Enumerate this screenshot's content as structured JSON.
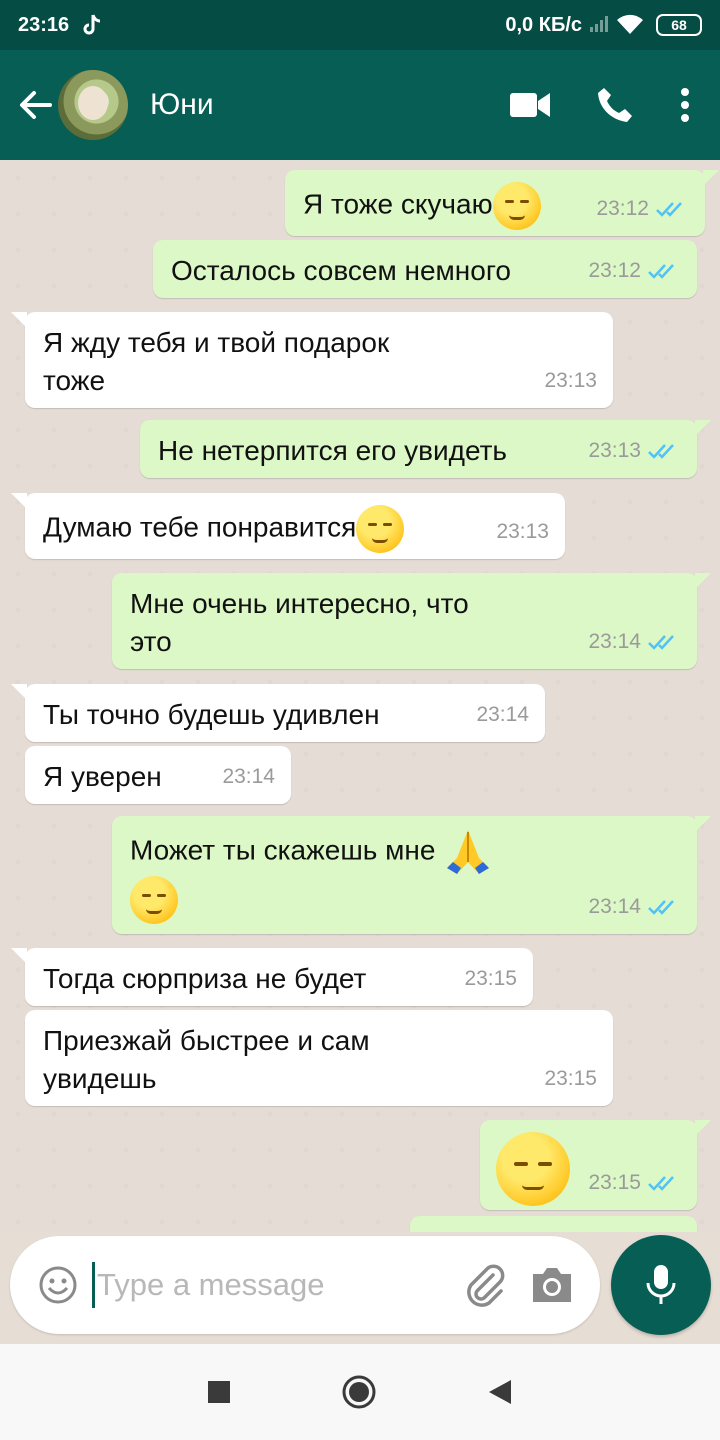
{
  "status_bar": {
    "time": "23:16",
    "network_speed": "0,0 КБ/с",
    "battery": "68",
    "icons": [
      "tiktok-icon",
      "signal-icon",
      "wifi-icon",
      "battery-icon"
    ]
  },
  "header": {
    "contact_name": "Юни",
    "icons": [
      "back-arrow-icon",
      "video-call-icon",
      "voice-call-icon",
      "more-options-icon"
    ]
  },
  "messages": [
    {
      "direction": "out",
      "text": "Я тоже скучаю",
      "emoji": "pensive-face",
      "time": "23:12",
      "status": "read"
    },
    {
      "direction": "out",
      "text": "Осталось совсем немного",
      "time": "23:12",
      "status": "read"
    },
    {
      "direction": "in",
      "text_line1": "Я жду тебя и твой подарок",
      "text_line2": "тоже",
      "time": "23:13"
    },
    {
      "direction": "out",
      "text": "Не нетерпится его увидеть",
      "time": "23:13",
      "status": "read"
    },
    {
      "direction": "in",
      "text": "Думаю тебе понравится",
      "emoji": "winking-face",
      "time": "23:13"
    },
    {
      "direction": "out",
      "text_line1": "Мне очень интересно, что",
      "text_line2": "это",
      "time": "23:14",
      "status": "read"
    },
    {
      "direction": "in",
      "text": "Ты точно будешь удивлен",
      "time": "23:14"
    },
    {
      "direction": "in",
      "text": "Я уверен",
      "time": "23:14"
    },
    {
      "direction": "out",
      "text": "Может ты скажешь мне",
      "emoji": "folded-hands",
      "emoji2": "smirking-face",
      "time": "23:14",
      "status": "read"
    },
    {
      "direction": "in",
      "text": "Тогда сюрприза не будет",
      "time": "23:15"
    },
    {
      "direction": "in",
      "text_line1": "Приезжай быстрее и сам",
      "text_line2": "увидешь",
      "time": "23:15"
    },
    {
      "direction": "out",
      "emoji": "pensive-face",
      "time": "23:15",
      "status": "read"
    }
  ],
  "composer": {
    "placeholder": "Type a message",
    "value": "",
    "icons": [
      "emoji-icon",
      "attach-icon",
      "camera-icon",
      "mic-icon"
    ]
  },
  "nav": {
    "icons": [
      "recents-icon",
      "home-icon",
      "back-icon"
    ]
  },
  "colors": {
    "header": "#075e54",
    "status_bar": "#054d44",
    "outgoing_bubble": "#dcf8c6",
    "incoming_bubble": "#ffffff",
    "read_ticks": "#4fc3f7",
    "chat_background": "#e5ddd5"
  }
}
